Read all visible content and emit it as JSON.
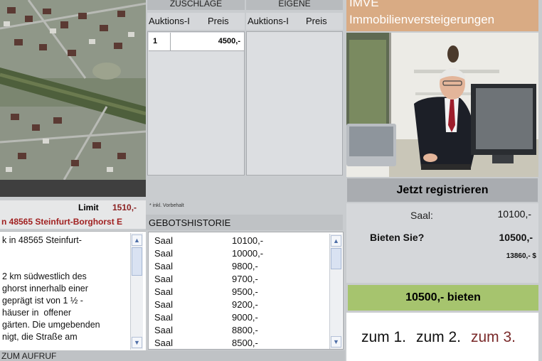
{
  "brand": {
    "top_text": "IMVE",
    "name": "Immobilienversteigerungen"
  },
  "auction_tables": {
    "zuschlaege": {
      "title": "ZUSCHLÄGE",
      "columns": [
        "Auktions-I",
        "Preis"
      ],
      "rows": [
        {
          "index": "1",
          "price": "4500,-"
        }
      ]
    },
    "eigene": {
      "title": "EIGENE",
      "columns": [
        "Auktions-I",
        "Preis"
      ]
    },
    "note": "* inkl. Vorbehalt"
  },
  "property": {
    "limit_label": "Limit",
    "limit_value": "1510,-",
    "location": "n 48565 Steinfurt-Borghorst E",
    "description_lines": [
      "k in 48565 Steinfurt-",
      "",
      "",
      "2 km südwestlich des",
      "ghorst innerhalb einer",
      "geprägt ist von 1 ½ -",
      "häuser in  offener",
      "gärten. Die umgebenden",
      "nigt, die Straße am"
    ]
  },
  "bid_history": {
    "title": "GEBOTSHISTORIE",
    "rows": [
      {
        "who": "Saal",
        "amount": "10100,-"
      },
      {
        "who": "Saal",
        "amount": "10000,-"
      },
      {
        "who": "Saal",
        "amount": "9800,-"
      },
      {
        "who": "Saal",
        "amount": "9700,-"
      },
      {
        "who": "Saal",
        "amount": "9500,-"
      },
      {
        "who": "Saal",
        "amount": "9200,-"
      },
      {
        "who": "Saal",
        "amount": "9000,-"
      },
      {
        "who": "Saal",
        "amount": "8800,-"
      },
      {
        "who": "Saal",
        "amount": "8500,-"
      }
    ]
  },
  "register_button": "Jetzt registrieren",
  "bid_info": {
    "saal_label": "Saal:",
    "saal_value": "10100,-",
    "bieten_label": "Bieten Sie?",
    "bieten_value": "10500,-",
    "small_value": "13860,- $"
  },
  "bid_button": "10500,-  bieten",
  "countdown": {
    "first": "zum 1.",
    "second": "zum 2.",
    "third": "zum 3."
  },
  "bottom_link": "ZUM AUFRUF",
  "colors": {
    "brand_bg": "#d9ab84",
    "bid_button": "#a6c46e",
    "limit_red": "#8a1f1f",
    "location_red": "#a02020"
  }
}
